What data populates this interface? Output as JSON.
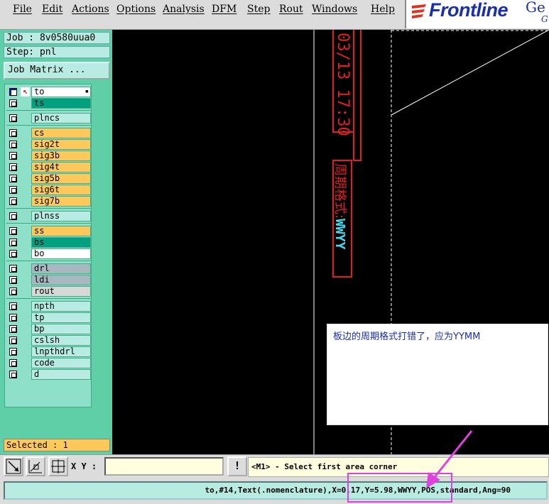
{
  "menubar": {
    "items": [
      "File",
      "Edit",
      "Actions",
      "Options",
      "Analysis",
      "DFM",
      "Step",
      "Rout",
      "Windows",
      "Help"
    ],
    "logo_text": "Frontline",
    "logo_extra": "Ge",
    "logo_extra2": "G"
  },
  "sidebar": {
    "job": "Job : 8v0580uua0",
    "step": "Step: pnl",
    "job_matrix_label": "Job Matrix ...",
    "layers": [
      {
        "name": "to",
        "color": "#ffffff",
        "active": true,
        "arrow": true
      },
      {
        "name": "ts",
        "color": "#00a080"
      },
      {
        "name": "plncs",
        "color": "#b8ece2"
      },
      {
        "name": "cs",
        "color": "#ffc85a"
      },
      {
        "name": "sig2t",
        "color": "#ffc85a"
      },
      {
        "name": "sig3b",
        "color": "#ffc85a"
      },
      {
        "name": "sig4t",
        "color": "#ffc85a"
      },
      {
        "name": "sig5b",
        "color": "#ffc85a"
      },
      {
        "name": "sig6t",
        "color": "#ffc85a"
      },
      {
        "name": "sig7b",
        "color": "#ffc85a"
      },
      {
        "name": "plnss",
        "color": "#b8ece2"
      },
      {
        "name": "ss",
        "color": "#ffc85a"
      },
      {
        "name": "bs",
        "color": "#00a080"
      },
      {
        "name": "bo",
        "color": "#ffffff"
      },
      {
        "name": "drl",
        "color": "#a8b8c0"
      },
      {
        "name": "ldi",
        "color": "#a8b8c0"
      },
      {
        "name": "rout",
        "color": "#d8d8d8"
      },
      {
        "name": "npth",
        "color": "#b8ece2"
      },
      {
        "name": "tp",
        "color": "#b8ece2"
      },
      {
        "name": "bp",
        "color": "#b8ece2"
      },
      {
        "name": "cslsh",
        "color": "#b8ece2"
      },
      {
        "name": "lnpthdrl",
        "color": "#b8ece2"
      },
      {
        "name": "code",
        "color": "#b8ece2"
      },
      {
        "name": "d",
        "color": "#b8ece2"
      }
    ],
    "selected": "Selected : 1"
  },
  "canvas": {
    "date_text": "03/13 17:30",
    "format_label": "周期格式:",
    "format_code": "WWYY"
  },
  "annotation": {
    "text": "板边的周期格式打错了，应为YYMM"
  },
  "toolbar": {
    "xy_label": "X Y :",
    "xy_value": "",
    "excl_label": "!",
    "prompt": "<M1> - Select first area corner"
  },
  "status": {
    "text": "to,#14,Text(.nomenclature),X=0.17,Y=5.98,WWYY,POS,standard,Ang=90"
  },
  "colors": {
    "accent": "#e040e0",
    "logo": "#1a2fb0",
    "text_red": "#e02020",
    "text_cyan": "#40e0f0"
  }
}
